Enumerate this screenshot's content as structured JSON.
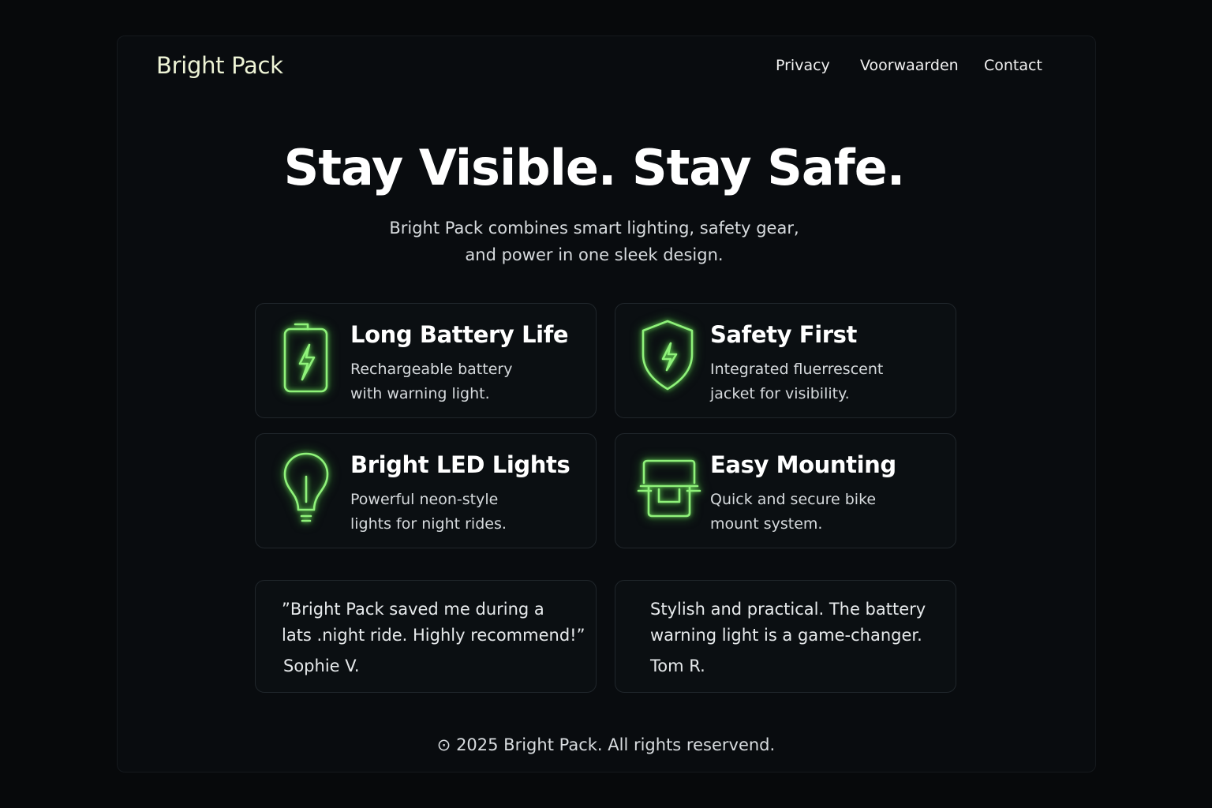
{
  "header": {
    "brand": "Bright Pack",
    "nav": [
      {
        "label": "Privacy"
      },
      {
        "label": "Voorwaarden"
      },
      {
        "label": "Contact"
      }
    ]
  },
  "hero": {
    "title": "Stay Visible. Stay Safe.",
    "subtitle_line1": "Bright Pack combines smart lighting, safety gear,",
    "subtitle_line2": "and power in one sleek design."
  },
  "features": [
    {
      "icon": "battery-bolt-icon",
      "title": "Long Battery Life",
      "desc_line1": "Rechargeable battery",
      "desc_line2": "with warning light."
    },
    {
      "icon": "shield-bolt-icon",
      "title": "Safety First",
      "desc_line1": "Integrated fluerrescent",
      "desc_line2": "jacket for visibility."
    },
    {
      "icon": "lightbulb-icon",
      "title": "Bright LED Lights",
      "desc_line1": "Powerful neon-style",
      "desc_line2": "lights for night rides."
    },
    {
      "icon": "mount-icon",
      "title": "Easy Mounting",
      "desc_line1": "Quick and secure bike",
      "desc_line2": "mount system."
    }
  ],
  "testimonials": [
    {
      "line1": "”Bright Pack saved me during a",
      "line2": "lats .night ride. Highly recommend!”",
      "author": "Sophie V."
    },
    {
      "line1": "Stylish and practical. The battery",
      "line2": "warning light is a game-changer.",
      "author": "Tom R."
    }
  ],
  "footer": {
    "text": "⊙ 2025 Bright Pack. All rights reservend."
  },
  "colors": {
    "background": "#07090b",
    "accent_glow": "#7ee86a",
    "brand_text": "#eef4d6"
  }
}
